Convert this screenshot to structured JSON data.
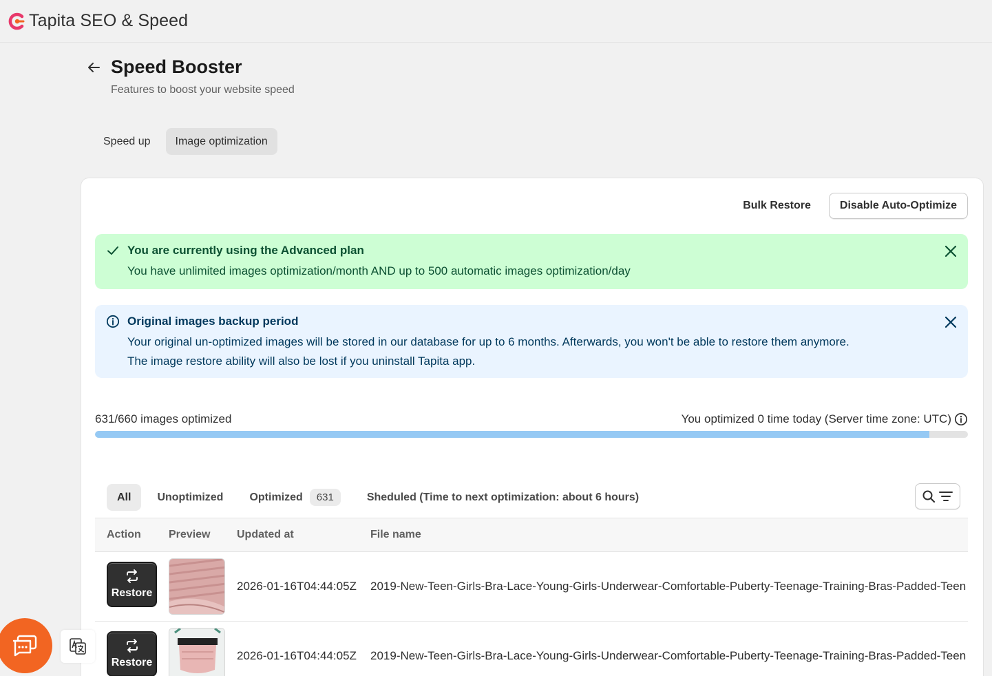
{
  "app": {
    "title": "Tapita SEO & Speed"
  },
  "page": {
    "title": "Speed Booster",
    "subtitle": "Features to boost your website speed"
  },
  "tabs": [
    {
      "label": "Speed up"
    },
    {
      "label": "Image optimization",
      "active": true
    }
  ],
  "actions": {
    "bulk_restore": "Bulk Restore",
    "disable_auto": "Disable Auto-Optimize"
  },
  "banners": {
    "plan": {
      "title": "You are currently using the Advanced plan",
      "text": "You have unlimited images optimization/month AND up to 500 automatic images optimization/day"
    },
    "backup": {
      "title": "Original images backup period",
      "line1": "Your original un-optimized images will be stored in our database for up to 6 months. Afterwards, you won't be able to restore them anymore.",
      "line2": "The image restore ability will also be lost if you uninstall Tapita app."
    }
  },
  "progress": {
    "label": "631/660 images optimized",
    "status": "You optimized 0 time today (Server time zone: UTC)",
    "optimized": 631,
    "total": 660
  },
  "filters": {
    "all": "All",
    "unoptimized": "Unoptimized",
    "optimized": "Optimized",
    "optimized_count": "631",
    "scheduled": "Sheduled (Time to next optimization: about 6 hours)"
  },
  "table": {
    "headers": {
      "action": "Action",
      "preview": "Preview",
      "updated": "Updated at",
      "file": "File name"
    },
    "rows": [
      {
        "action": "Restore",
        "updated": "2026-01-16T04:44:05Z",
        "file": "2019-New-Teen-Girls-Bra-Lace-Young-Girls-Underwear-Comfortable-Puberty-Teenage-Training-Bras-Padded-Teen"
      },
      {
        "action": "Restore",
        "updated": "2026-01-16T04:44:05Z",
        "file": "2019-New-Teen-Girls-Bra-Lace-Young-Girls-Underwear-Comfortable-Puberty-Teenage-Training-Bras-Padded-Teen"
      }
    ]
  },
  "colors": {
    "success_bg": "#cdfed4",
    "info_bg": "#eaf4ff",
    "progress_fill": "#95c9f4",
    "chat": "#f26522"
  }
}
